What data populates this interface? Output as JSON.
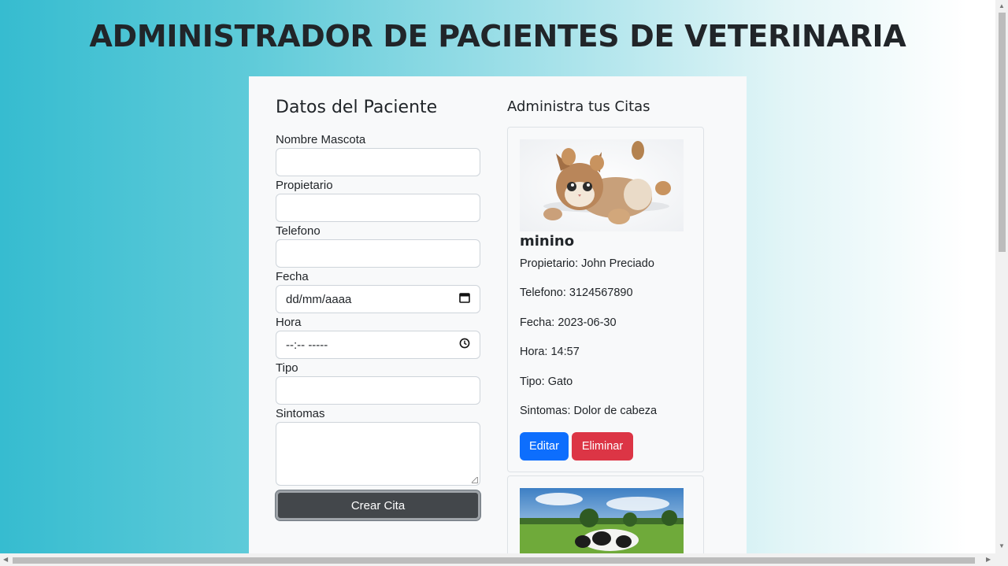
{
  "page": {
    "title": "ADMINISTRADOR DE PACIENTES DE VETERINARIA"
  },
  "form": {
    "heading": "Datos del Paciente",
    "fields": [
      {
        "label": "Nombre Mascota",
        "value": ""
      },
      {
        "label": "Propietario",
        "value": ""
      },
      {
        "label": "Telefono",
        "value": ""
      },
      {
        "label": "Fecha",
        "value": "dd/mm/aaaa",
        "icon": "calendar-icon"
      },
      {
        "label": "Hora",
        "value": "--:-- -----",
        "icon": "clock-icon"
      },
      {
        "label": "Tipo",
        "value": ""
      },
      {
        "label": "Sintomas",
        "value": ""
      }
    ],
    "submit_label": "Crear Cita"
  },
  "appointments": {
    "heading": "Administra tus Citas",
    "items": [
      {
        "image": "kitten-photo",
        "name": "minino",
        "owner": "Propietario: John Preciado",
        "phone": "Telefono: 3124567890",
        "date": "Fecha: 2023-06-30",
        "time": "Hora: 14:57",
        "type": "Tipo: Gato",
        "symptoms": "Sintomas: Dolor de cabeza",
        "edit_label": "Editar",
        "delete_label": "Eliminar"
      },
      {
        "image": "cow-photo"
      }
    ]
  },
  "colors": {
    "edit": "#0d6efd",
    "delete": "#dc3545",
    "submit": "#43474b",
    "panel": "#f8f9fa"
  }
}
